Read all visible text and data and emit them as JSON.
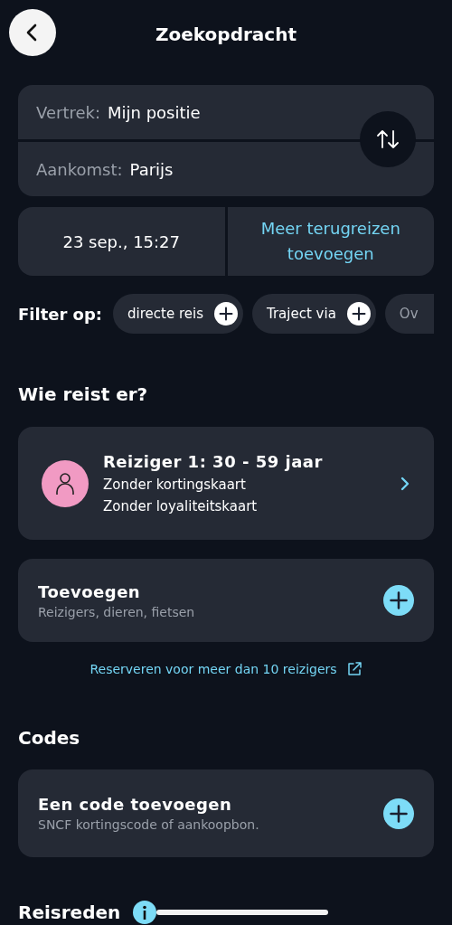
{
  "header": {
    "title": "Zoekopdracht"
  },
  "route": {
    "departure": {
      "label": "Vertrek:",
      "value": "Mijn positie"
    },
    "arrival": {
      "label": "Aankomst:",
      "value": "Parijs"
    }
  },
  "date": {
    "value": "23 sep., 15:27"
  },
  "return_link": "Meer terugreizen toevoegen",
  "filters": {
    "label": "Filter op:",
    "chips": [
      {
        "label": "directe reis",
        "cut": false
      },
      {
        "label": "Traject via",
        "cut": false
      },
      {
        "label": "Ov",
        "cut": true
      }
    ]
  },
  "travelers": {
    "heading": "Wie reist er?",
    "items": [
      {
        "title": "Reiziger 1: 30 - 59 jaar",
        "lines": [
          "Zonder kortingskaart",
          "Zonder loyaliteitskaart"
        ],
        "color": "#f19ac3"
      }
    ],
    "add": {
      "title": "Toevoegen",
      "subtitle": "Reizigers, dieren, fietsen"
    },
    "group_link": "Reserveren voor meer dan 10 reizigers"
  },
  "codes": {
    "heading": "Codes",
    "add": {
      "title": "Een code toevoegen",
      "subtitle": "SNCF kortingscode of aankoopbon."
    }
  },
  "reason": {
    "heading": "Reisreden"
  }
}
